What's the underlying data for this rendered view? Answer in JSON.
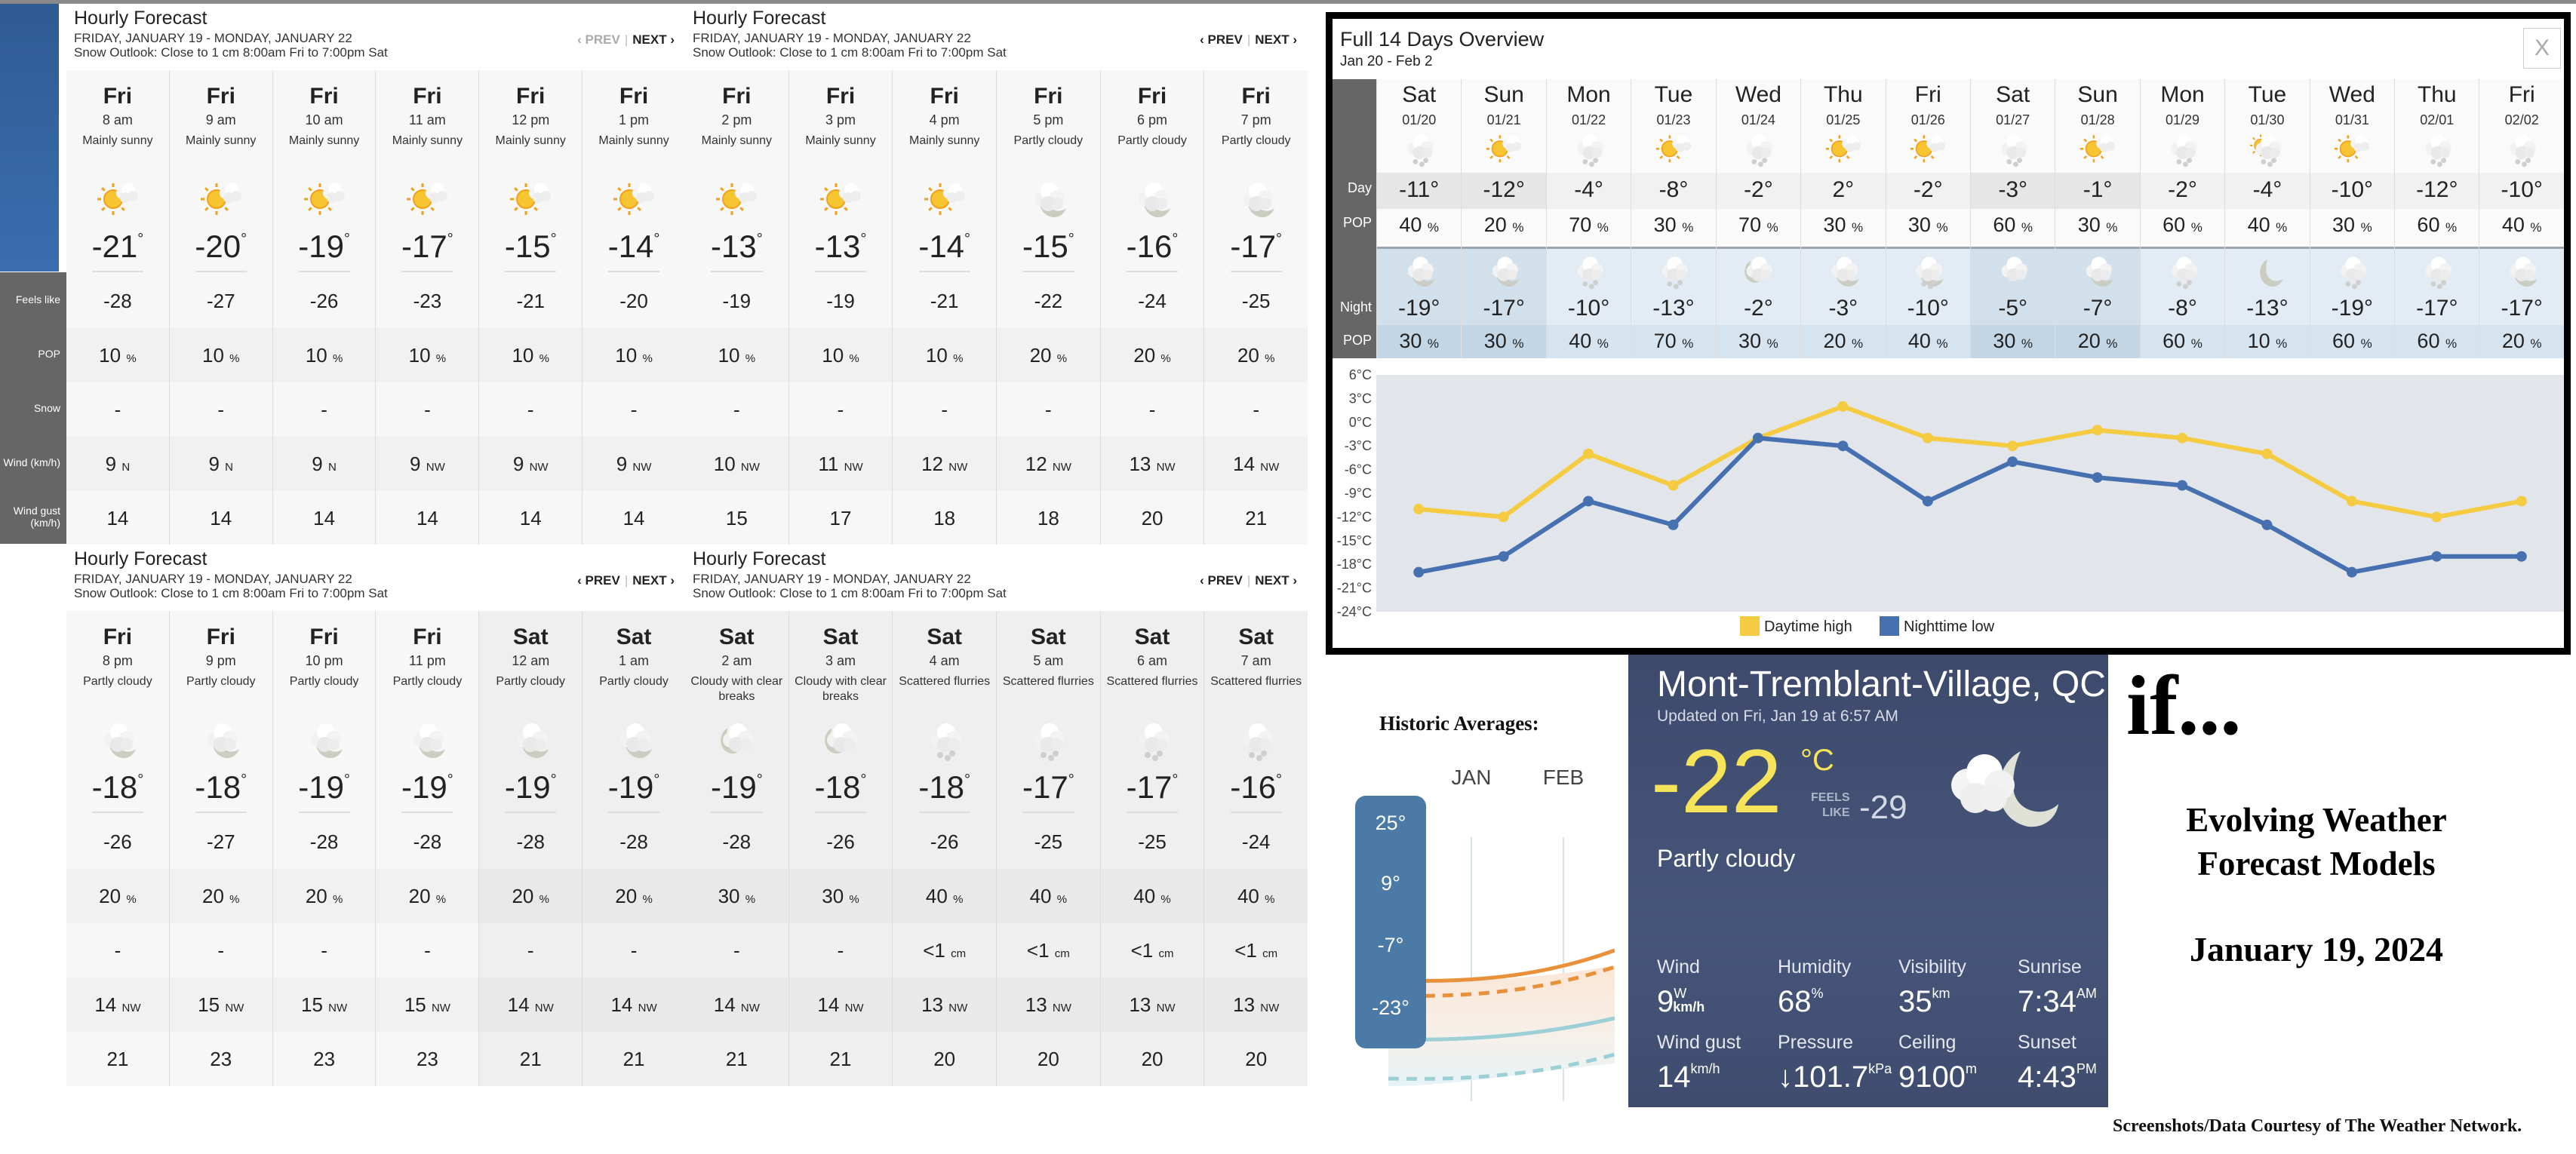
{
  "hourly_panels": [
    {
      "title": "Hourly Forecast",
      "dates": "FRIDAY, JANUARY 19 - MONDAY, JANUARY 22",
      "outlook": "Snow Outlook: Close to 1 cm 8:00am Fri to 7:00pm Sat",
      "prev_label": "‹ PREV",
      "next_label": "NEXT ›",
      "prev_disabled": true,
      "hours": [
        {
          "day": "Fri",
          "time": "8 am",
          "cond": "Mainly sunny",
          "icon": "sun-cloud-icon",
          "temp": "-21",
          "feels": "-28",
          "pop": "10",
          "snow": "-",
          "wind": "9",
          "dir": "N",
          "gust": "14"
        },
        {
          "day": "Fri",
          "time": "9 am",
          "cond": "Mainly sunny",
          "icon": "sun-cloud-icon",
          "temp": "-20",
          "feels": "-27",
          "pop": "10",
          "snow": "-",
          "wind": "9",
          "dir": "N",
          "gust": "14"
        },
        {
          "day": "Fri",
          "time": "10 am",
          "cond": "Mainly sunny",
          "icon": "sun-cloud-icon",
          "temp": "-19",
          "feels": "-26",
          "pop": "10",
          "snow": "-",
          "wind": "9",
          "dir": "N",
          "gust": "14"
        },
        {
          "day": "Fri",
          "time": "11 am",
          "cond": "Mainly sunny",
          "icon": "sun-cloud-icon",
          "temp": "-17",
          "feels": "-23",
          "pop": "10",
          "snow": "-",
          "wind": "9",
          "dir": "NW",
          "gust": "14"
        },
        {
          "day": "Fri",
          "time": "12 pm",
          "cond": "Mainly sunny",
          "icon": "sun-cloud-icon",
          "temp": "-15",
          "feels": "-21",
          "pop": "10",
          "snow": "-",
          "wind": "9",
          "dir": "NW",
          "gust": "14"
        },
        {
          "day": "Fri",
          "time": "1 pm",
          "cond": "Mainly sunny",
          "icon": "sun-cloud-icon",
          "temp": "-14",
          "feels": "-20",
          "pop": "10",
          "snow": "-",
          "wind": "9",
          "dir": "NW",
          "gust": "14"
        }
      ]
    },
    {
      "title": "Hourly Forecast",
      "dates": "FRIDAY, JANUARY 19 - MONDAY, JANUARY 22",
      "outlook": "Snow Outlook: Close to 1 cm 8:00am Fri to 7:00pm Sat",
      "prev_label": "‹ PREV",
      "next_label": "NEXT ›",
      "prev_disabled": false,
      "hours": [
        {
          "day": "Fri",
          "time": "2 pm",
          "cond": "Mainly sunny",
          "icon": "sun-cloud-icon",
          "temp": "-13",
          "feels": "-19",
          "pop": "10",
          "snow": "-",
          "wind": "10",
          "dir": "NW",
          "gust": "15"
        },
        {
          "day": "Fri",
          "time": "3 pm",
          "cond": "Mainly sunny",
          "icon": "sun-cloud-icon",
          "temp": "-13",
          "feels": "-19",
          "pop": "10",
          "snow": "-",
          "wind": "11",
          "dir": "NW",
          "gust": "17"
        },
        {
          "day": "Fri",
          "time": "4 pm",
          "cond": "Mainly sunny",
          "icon": "sun-cloud-icon",
          "temp": "-14",
          "feels": "-21",
          "pop": "10",
          "snow": "-",
          "wind": "12",
          "dir": "NW",
          "gust": "18"
        },
        {
          "day": "Fri",
          "time": "5 pm",
          "cond": "Partly cloudy",
          "icon": "moon-cloud-icon",
          "temp": "-15",
          "feels": "-22",
          "pop": "20",
          "snow": "-",
          "wind": "12",
          "dir": "NW",
          "gust": "18"
        },
        {
          "day": "Fri",
          "time": "6 pm",
          "cond": "Partly cloudy",
          "icon": "moon-cloud-icon",
          "temp": "-16",
          "feels": "-24",
          "pop": "20",
          "snow": "-",
          "wind": "13",
          "dir": "NW",
          "gust": "20"
        },
        {
          "day": "Fri",
          "time": "7 pm",
          "cond": "Partly cloudy",
          "icon": "moon-cloud-icon",
          "temp": "-17",
          "feels": "-25",
          "pop": "20",
          "snow": "-",
          "wind": "14",
          "dir": "NW",
          "gust": "21"
        }
      ]
    },
    {
      "title": "Hourly Forecast",
      "dates": "FRIDAY, JANUARY 19 - MONDAY, JANUARY 22",
      "outlook": "Snow Outlook: Close to 1 cm 8:00am Fri to 7:00pm Sat",
      "prev_label": "‹ PREV",
      "next_label": "NEXT ›",
      "prev_disabled": false,
      "hours": [
        {
          "day": "Fri",
          "time": "8 pm",
          "cond": "Partly cloudy",
          "icon": "moon-cloud-icon",
          "temp": "-18",
          "feels": "-26",
          "pop": "20",
          "snow": "-",
          "wind": "14",
          "dir": "NW",
          "gust": "21"
        },
        {
          "day": "Fri",
          "time": "9 pm",
          "cond": "Partly cloudy",
          "icon": "moon-cloud-icon",
          "temp": "-18",
          "feels": "-27",
          "pop": "20",
          "snow": "-",
          "wind": "15",
          "dir": "NW",
          "gust": "23"
        },
        {
          "day": "Fri",
          "time": "10 pm",
          "cond": "Partly cloudy",
          "icon": "moon-cloud-icon",
          "temp": "-19",
          "feels": "-28",
          "pop": "20",
          "snow": "-",
          "wind": "15",
          "dir": "NW",
          "gust": "23"
        },
        {
          "day": "Fri",
          "time": "11 pm",
          "cond": "Partly cloudy",
          "icon": "moon-cloud-icon",
          "temp": "-19",
          "feels": "-28",
          "pop": "20",
          "snow": "-",
          "wind": "15",
          "dir": "NW",
          "gust": "23"
        },
        {
          "day": "Sat",
          "time": "12 am",
          "cond": "Partly cloudy",
          "icon": "moon-cloud-icon",
          "temp": "-19",
          "feels": "-28",
          "pop": "20",
          "snow": "-",
          "wind": "14",
          "dir": "NW",
          "gust": "21"
        },
        {
          "day": "Sat",
          "time": "1 am",
          "cond": "Partly cloudy",
          "icon": "moon-cloud-icon",
          "temp": "-19",
          "feels": "-28",
          "pop": "20",
          "snow": "-",
          "wind": "14",
          "dir": "NW",
          "gust": "21"
        }
      ]
    },
    {
      "title": "Hourly Forecast",
      "dates": "FRIDAY, JANUARY 19 - MONDAY, JANUARY 22",
      "outlook": "Snow Outlook: Close to 1 cm 8:00am Fri to 7:00pm Sat",
      "prev_label": "‹ PREV",
      "next_label": "NEXT ›",
      "prev_disabled": false,
      "hours": [
        {
          "day": "Sat",
          "time": "2 am",
          "cond": "Cloudy with clear breaks",
          "icon": "moon-cloudy-icon",
          "temp": "-19",
          "feels": "-28",
          "pop": "30",
          "snow": "-",
          "wind": "14",
          "dir": "NW",
          "gust": "21"
        },
        {
          "day": "Sat",
          "time": "3 am",
          "cond": "Cloudy with clear breaks",
          "icon": "moon-cloudy-icon",
          "temp": "-18",
          "feels": "-26",
          "pop": "30",
          "snow": "-",
          "wind": "14",
          "dir": "NW",
          "gust": "21"
        },
        {
          "day": "Sat",
          "time": "4 am",
          "cond": "Scattered flurries",
          "icon": "snow-cloud-icon",
          "temp": "-18",
          "feels": "-26",
          "pop": "40",
          "snow": "<1",
          "snow_unit": "cm",
          "wind": "13",
          "dir": "NW",
          "gust": "20"
        },
        {
          "day": "Sat",
          "time": "5 am",
          "cond": "Scattered flurries",
          "icon": "snow-cloud-icon",
          "temp": "-17",
          "feels": "-25",
          "pop": "40",
          "snow": "<1",
          "snow_unit": "cm",
          "wind": "13",
          "dir": "NW",
          "gust": "20"
        },
        {
          "day": "Sat",
          "time": "6 am",
          "cond": "Scattered flurries",
          "icon": "snow-cloud-icon",
          "temp": "-17",
          "feels": "-25",
          "pop": "40",
          "snow": "<1",
          "snow_unit": "cm",
          "wind": "13",
          "dir": "NW",
          "gust": "20"
        },
        {
          "day": "Sat",
          "time": "7 am",
          "cond": "Scattered flurries",
          "icon": "snow-cloud-icon",
          "temp": "-16",
          "feels": "-24",
          "pop": "40",
          "snow": "<1",
          "snow_unit": "cm",
          "wind": "13",
          "dir": "NW",
          "gust": "20"
        }
      ]
    }
  ],
  "row_labels": [
    "Feels like",
    "POP",
    "Snow",
    "Wind (km/h)",
    "Wind gust (km/h)"
  ],
  "units": {
    "percent": "%",
    "degree": "°"
  },
  "overview": {
    "title": "Full 14 Days Overview",
    "dates": "Jan 20 - Feb 2",
    "close_label": "X",
    "labels": {
      "day": "Day",
      "pop": "POP",
      "night": "Night"
    },
    "days": [
      {
        "day": "Sat",
        "date": "01/20",
        "day_icon": "snow-cloud-icon",
        "hi": "-11°",
        "pop": "40",
        "night_icon": "moon-cloud-icon",
        "lo": "-19°",
        "npop": "30",
        "hl": true
      },
      {
        "day": "Sun",
        "date": "01/21",
        "day_icon": "sun-cloud-icon",
        "hi": "-12°",
        "pop": "20",
        "night_icon": "moon-cloud-icon",
        "lo": "-17°",
        "npop": "30",
        "hl": true
      },
      {
        "day": "Mon",
        "date": "01/22",
        "day_icon": "snow-cloud-icon",
        "hi": "-4°",
        "pop": "70",
        "night_icon": "snow-cloud-icon",
        "lo": "-10°",
        "npop": "40",
        "hl": false
      },
      {
        "day": "Tue",
        "date": "01/23",
        "day_icon": "sun-cloud-icon",
        "hi": "-8°",
        "pop": "30",
        "night_icon": "snow-cloud-icon",
        "lo": "-13°",
        "npop": "70",
        "hl": false
      },
      {
        "day": "Wed",
        "date": "01/24",
        "day_icon": "snow-cloud-icon",
        "hi": "-2°",
        "pop": "70",
        "night_icon": "moon-cloudy-icon",
        "lo": "-2°",
        "npop": "30",
        "hl": false
      },
      {
        "day": "Thu",
        "date": "01/25",
        "day_icon": "sun-cloud-icon",
        "hi": "2°",
        "pop": "30",
        "night_icon": "moon-cloud-icon",
        "lo": "-3°",
        "npop": "20",
        "hl": false
      },
      {
        "day": "Fri",
        "date": "01/26",
        "day_icon": "sun-cloud-icon",
        "hi": "-2°",
        "pop": "30",
        "night_icon": "moon-snow-icon",
        "lo": "-10°",
        "npop": "40",
        "hl": false
      },
      {
        "day": "Sat",
        "date": "01/27",
        "day_icon": "snow-cloud-icon",
        "hi": "-3°",
        "pop": "60",
        "night_icon": "cloud-icon",
        "lo": "-5°",
        "npop": "30",
        "hl": true
      },
      {
        "day": "Sun",
        "date": "01/28",
        "day_icon": "sun-cloud-icon",
        "hi": "-1°",
        "pop": "30",
        "night_icon": "moon-cloud-icon",
        "lo": "-7°",
        "npop": "20",
        "hl": true
      },
      {
        "day": "Mon",
        "date": "01/29",
        "day_icon": "snow-cloud-icon",
        "hi": "-2°",
        "pop": "60",
        "night_icon": "snow-cloud-icon",
        "lo": "-8°",
        "npop": "60",
        "hl": false
      },
      {
        "day": "Tue",
        "date": "01/30",
        "day_icon": "sun-snow-icon",
        "hi": "-4°",
        "pop": "40",
        "night_icon": "moon-icon",
        "lo": "-13°",
        "npop": "10",
        "hl": false
      },
      {
        "day": "Wed",
        "date": "01/31",
        "day_icon": "sun-cloud-icon",
        "hi": "-10°",
        "pop": "30",
        "night_icon": "snow-cloud-icon",
        "lo": "-19°",
        "npop": "60",
        "hl": false
      },
      {
        "day": "Thu",
        "date": "02/01",
        "day_icon": "snow-cloud-icon",
        "hi": "-12°",
        "pop": "60",
        "night_icon": "snow-cloud-icon",
        "lo": "-17°",
        "npop": "60",
        "hl": false
      },
      {
        "day": "Fri",
        "date": "02/02",
        "day_icon": "snow-cloud-icon",
        "hi": "-10°",
        "pop": "40",
        "night_icon": "moon-cloud-icon",
        "lo": "-17°",
        "npop": "20",
        "hl": false
      }
    ]
  },
  "chart_data": {
    "type": "line",
    "title": "",
    "xlabel": "",
    "ylabel": "",
    "categories": [
      "01/20",
      "01/21",
      "01/22",
      "01/23",
      "01/24",
      "01/25",
      "01/26",
      "01/27",
      "01/28",
      "01/29",
      "01/30",
      "01/31",
      "02/01",
      "02/02"
    ],
    "series": [
      {
        "name": "Daytime high",
        "color": "#f5cb42",
        "values": [
          -11,
          -12,
          -4,
          -8,
          -2,
          2,
          -2,
          -3,
          -1,
          -2,
          -4,
          -10,
          -12,
          -10
        ]
      },
      {
        "name": "Nighttime low",
        "color": "#4670b0",
        "values": [
          -19,
          -17,
          -10,
          -13,
          -2,
          -3,
          -10,
          -5,
          -7,
          -8,
          -13,
          -19,
          -17,
          -17
        ]
      }
    ],
    "ylim": [
      -24,
      6
    ],
    "yticks": [
      6,
      3,
      0,
      -3,
      -6,
      -9,
      -12,
      -15,
      -18,
      -21,
      -24
    ],
    "ytick_suffix": "°C",
    "grid": false,
    "legend": "bottom-center",
    "plot_bg": "#e2e6ea"
  },
  "historic": {
    "title": "Historic Averages:",
    "months": [
      "JAN",
      "FEB"
    ],
    "scale_labels": [
      "25°",
      "9°",
      "-7°",
      "-23°"
    ],
    "colors": {
      "high": "#e8913a",
      "low": "#9ccfd6",
      "scale_bg": "#4a7aa5"
    }
  },
  "current": {
    "city": "Mont-Tremblant-Village, QC",
    "updated": "Updated on Fri, Jan 19 at 6:57 AM",
    "temp": "-22",
    "unit": "°C",
    "feels_label_1": "FEELS",
    "feels_label_2": "LIKE",
    "feels": "-29",
    "condition": "Partly cloudy",
    "icon": "moon-cloud-icon",
    "stats": [
      {
        "label": "Wind",
        "value": "9",
        "sup": "W",
        "sub": "km/h"
      },
      {
        "label": "Humidity",
        "value": "68",
        "sup": "%"
      },
      {
        "label": "Visibility",
        "value": "35",
        "sup": "km"
      },
      {
        "label": "Sunrise",
        "value": "7:34",
        "sup": "AM"
      },
      {
        "label": "Wind gust",
        "value": "14",
        "sup": "km/h"
      },
      {
        "label": "Pressure",
        "value": "↓101.7",
        "sup": "kPa"
      },
      {
        "label": "Ceiling",
        "value": "9100",
        "sup": "m"
      },
      {
        "label": "Sunset",
        "value": "4:43",
        "sup": "PM"
      }
    ]
  },
  "annotations": {
    "if_text": "if...",
    "headline_1": "Evolving Weather",
    "headline_2": "Forecast Models",
    "date": "January 19, 2024",
    "credit": "Screenshots/Data Courtesy of The Weather Network."
  }
}
